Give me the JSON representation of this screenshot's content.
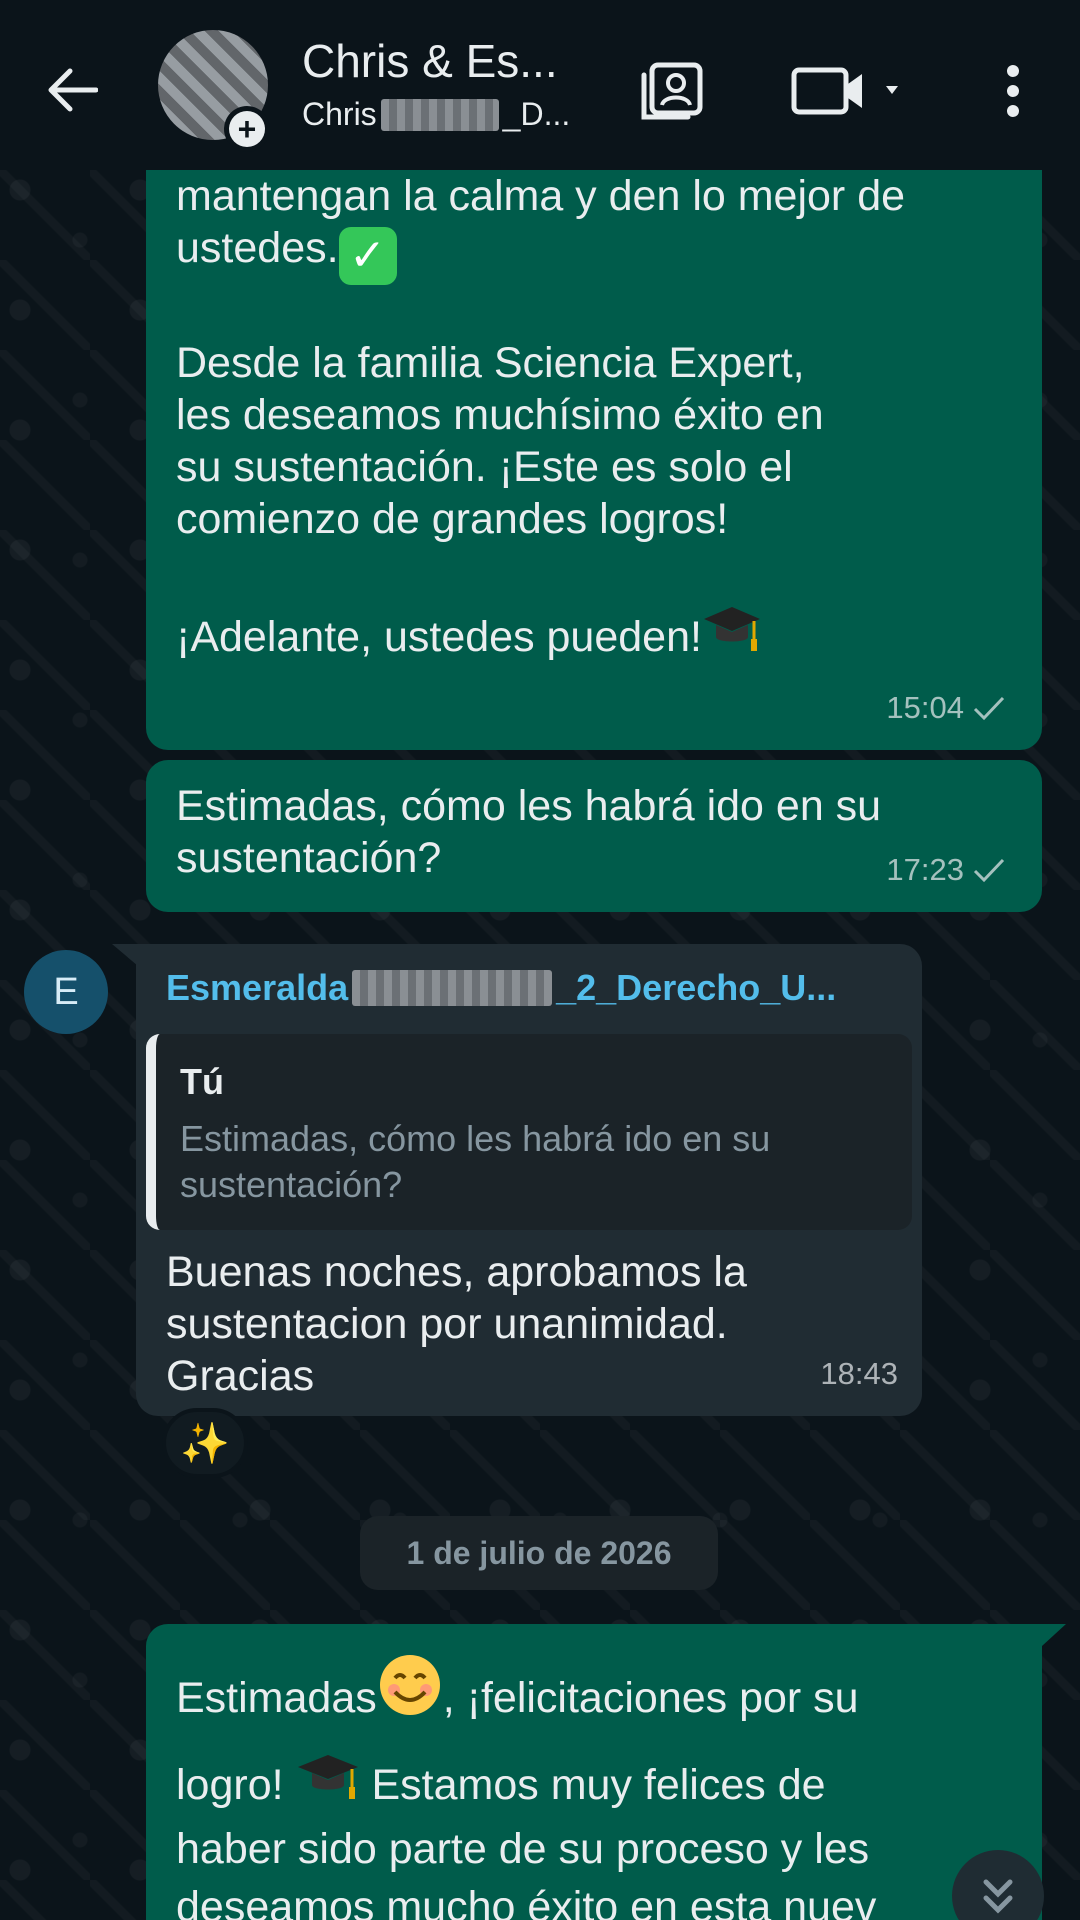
{
  "header": {
    "title": "Chris & Es...",
    "subtitle_prefix": "Chris",
    "subtitle_suffix": "_D..."
  },
  "messages": [
    {
      "id": "m1",
      "direction": "out",
      "text_lines": [
        "mantengan la calma y den lo mejor de",
        "ustedes.",
        "",
        "Desde la familia Sciencia Expert,",
        "les deseamos muchísimo éxito en",
        "su sustentación. ¡Este es solo el",
        "comienzo de grandes logros!",
        "",
        "¡Adelante, ustedes pueden!"
      ],
      "time": "15:04"
    },
    {
      "id": "m2",
      "direction": "out",
      "text": "Estimadas, cómo les habrá ido en su\nsustentación?",
      "time": "17:23"
    },
    {
      "id": "m3",
      "direction": "in",
      "avatar_letter": "E",
      "sender_prefix": "Esmeralda",
      "sender_suffix": "_2_Derecho_U...",
      "quote": {
        "author": "Tú",
        "text": "Estimadas, cómo les habrá ido en su\nsustentación?"
      },
      "text": "Buenas noches, aprobamos la\nsustentacion por unanimidad.\nGracias",
      "time": "18:43",
      "reaction": "✨"
    },
    {
      "id": "m4",
      "direction": "out",
      "line1_a": "Estimadas",
      "line1_b": ", ¡felicitaciones por su",
      "line2_a": "logro!",
      "line2_b": "Estamos muy felices de",
      "line3": "haber sido parte de su proceso y les",
      "line4": "deseamos mucho éxito en esta nuev"
    }
  ],
  "date_separator": "1 de julio de 2026",
  "colors": {
    "background": "#0b141a",
    "outgoing_bubble": "#005c4b",
    "incoming_bubble": "#202c33",
    "sender_name": "#53bdeb",
    "muted_text": "#8696a0"
  }
}
